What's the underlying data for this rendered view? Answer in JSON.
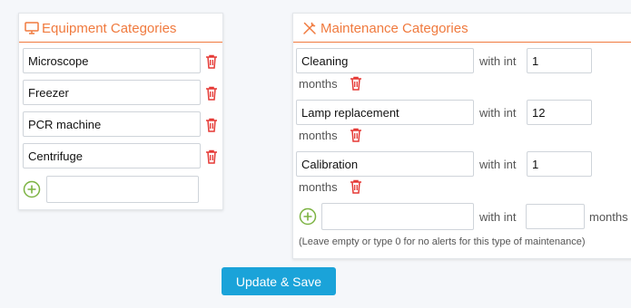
{
  "equipment": {
    "title": "Equipment Categories",
    "icon": "monitor-icon",
    "items": [
      {
        "value": "Microscope"
      },
      {
        "value": "Freezer"
      },
      {
        "value": "PCR machine"
      },
      {
        "value": "Centrifuge"
      }
    ],
    "new_item": {
      "value": "",
      "placeholder": ""
    }
  },
  "maintenance": {
    "title": "Maintenance Categories",
    "icon": "tools-icon",
    "items": [
      {
        "name": "Cleaning",
        "with_label": "with int",
        "interval": "1",
        "unit": "months"
      },
      {
        "name": "Lamp replacement",
        "with_label": "with int",
        "interval": "12",
        "unit": "months"
      },
      {
        "name": "Calibration",
        "with_label": "with int",
        "interval": "1",
        "unit": "months"
      }
    ],
    "new_item": {
      "name": "",
      "with_label": "with int",
      "interval": "",
      "unit": "months"
    },
    "note": "(Leave empty or type 0 for no alerts for this type of maintenance)"
  },
  "actions": {
    "save_label": "Update & Save"
  },
  "colors": {
    "accent": "#f07a3e",
    "delete": "#e53935",
    "add": "#7cb342",
    "button": "#1aa3d9"
  }
}
